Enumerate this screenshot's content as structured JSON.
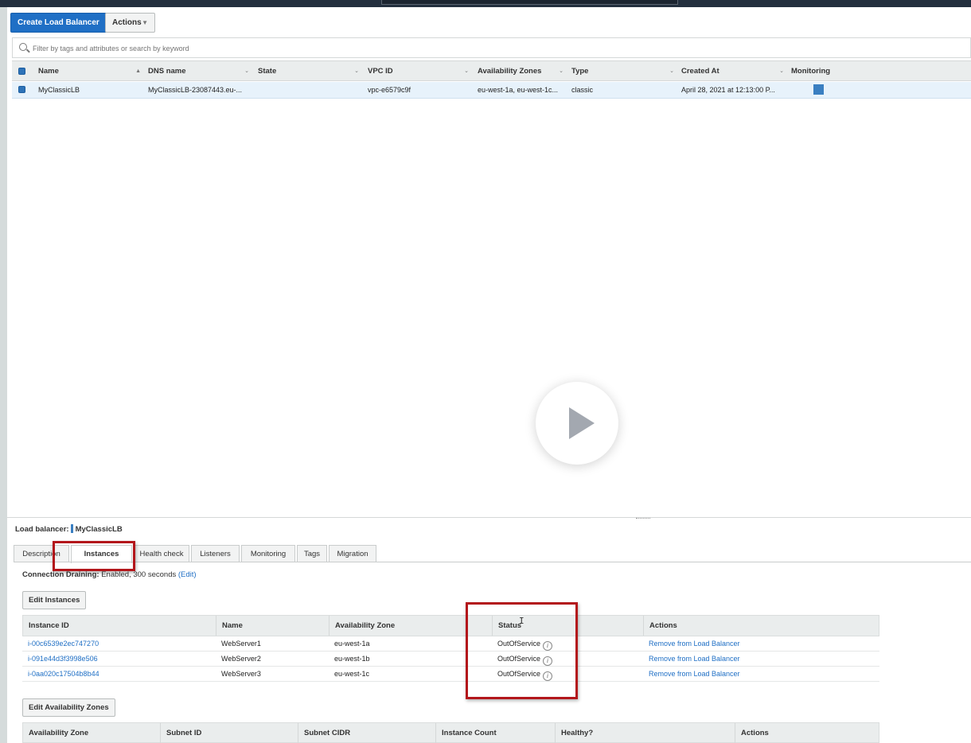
{
  "toolbar": {
    "create_label": "Create Load Balancer",
    "actions_label": "Actions",
    "actions_caret": "▼"
  },
  "filter": {
    "placeholder": "Filter by tags and attributes or search by keyword"
  },
  "lb_table": {
    "columns": [
      {
        "label": "Name"
      },
      {
        "label": "DNS name"
      },
      {
        "label": "State"
      },
      {
        "label": "VPC ID"
      },
      {
        "label": "Availability Zones"
      },
      {
        "label": "Type"
      },
      {
        "label": "Created At"
      },
      {
        "label": "Monitoring"
      }
    ],
    "rows": [
      {
        "name": "MyClassicLB",
        "dns": "MyClassicLB-23087443.eu-...",
        "state": "",
        "vpc": "vpc-e6579c9f",
        "azs": "eu-west-1a, eu-west-1c...",
        "type": "classic",
        "created": "April 28, 2021 at 12:13:00 P...",
        "monitoring_icon": "chart-square-icon"
      }
    ]
  },
  "details": {
    "label": "Load balancer:",
    "lb_name": "MyClassicLB",
    "tabs": [
      "Description",
      "Instances",
      "Health check",
      "Listeners",
      "Monitoring",
      "Tags",
      "Migration"
    ],
    "active_tab": "Instances",
    "connection_draining": {
      "label": "Connection Draining:",
      "value": "Enabled, 300 seconds",
      "edit": "(Edit)"
    },
    "edit_instances_label": "Edit Instances",
    "instances": {
      "columns": [
        "Instance ID",
        "Name",
        "Availability Zone",
        "Status",
        "Actions"
      ],
      "rows": [
        {
          "id": "i-00c6539e2ec747270",
          "name": "WebServer1",
          "az": "eu-west-1a",
          "status": "OutOfService",
          "action": "Remove from Load Balancer"
        },
        {
          "id": "i-091e44d3f3998e506",
          "name": "WebServer2",
          "az": "eu-west-1b",
          "status": "OutOfService",
          "action": "Remove from Load Balancer"
        },
        {
          "id": "i-0aa020c17504b8b44",
          "name": "WebServer3",
          "az": "eu-west-1c",
          "status": "OutOfService",
          "action": "Remove from Load Balancer"
        }
      ]
    },
    "edit_az_label": "Edit Availability Zones",
    "az_table": {
      "columns": [
        "Availability Zone",
        "Subnet ID",
        "Subnet CIDR",
        "Instance Count",
        "Healthy?",
        "Actions"
      ]
    }
  },
  "overlay": {
    "play_icon": "play-icon",
    "annotation_color": "#b3161b"
  },
  "colors": {
    "accent": "#1f6fc5",
    "selected_row": "#e7f2fb",
    "header_bg": "#eaeded"
  }
}
